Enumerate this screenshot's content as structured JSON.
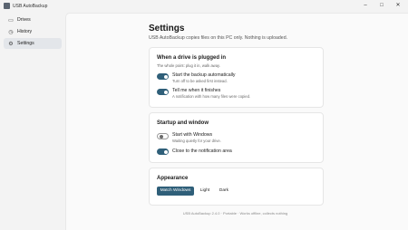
{
  "window": {
    "title": "USB AutoBackup",
    "minimize": "–",
    "maximize": "□",
    "close": "✕"
  },
  "sidebar": {
    "items": [
      {
        "label": "Drives",
        "icon": "drive-icon",
        "glyph": "▭",
        "active": false
      },
      {
        "label": "History",
        "icon": "history-icon",
        "glyph": "◷",
        "active": false
      },
      {
        "label": "Settings",
        "icon": "gear-icon",
        "glyph": "⚙",
        "active": true
      }
    ]
  },
  "header": {
    "title": "Settings",
    "subtitle": "USB AutoBackup copies files on this PC only. Nothing is uploaded."
  },
  "sections": {
    "plugged": {
      "title": "When a drive is plugged in",
      "subtitle": "The whole point: plug it in, walk away.",
      "options": [
        {
          "label": "Start the backup automatically",
          "desc": "Turn off to be asked first instead.",
          "on": true
        },
        {
          "label": "Tell me when it finishes",
          "desc": "A notification with how many files were copied.",
          "on": true
        }
      ]
    },
    "startup": {
      "title": "Startup and window",
      "options": [
        {
          "label": "Start with Windows",
          "desc": "Waiting quietly for your drive.",
          "on": false
        },
        {
          "label": "Close to the notification area",
          "on": true
        }
      ]
    },
    "appearance": {
      "title": "Appearance",
      "choices": [
        "Match Windows",
        "Light",
        "Dark"
      ],
      "selected": "Match Windows"
    }
  },
  "footer": {
    "text": "USB AutoBackup 2.4.0 · Portable · Works offline, collects nothing"
  },
  "colors": {
    "accent": "#2f5f79",
    "background": "#f3f3f3",
    "card": "#ffffff"
  }
}
